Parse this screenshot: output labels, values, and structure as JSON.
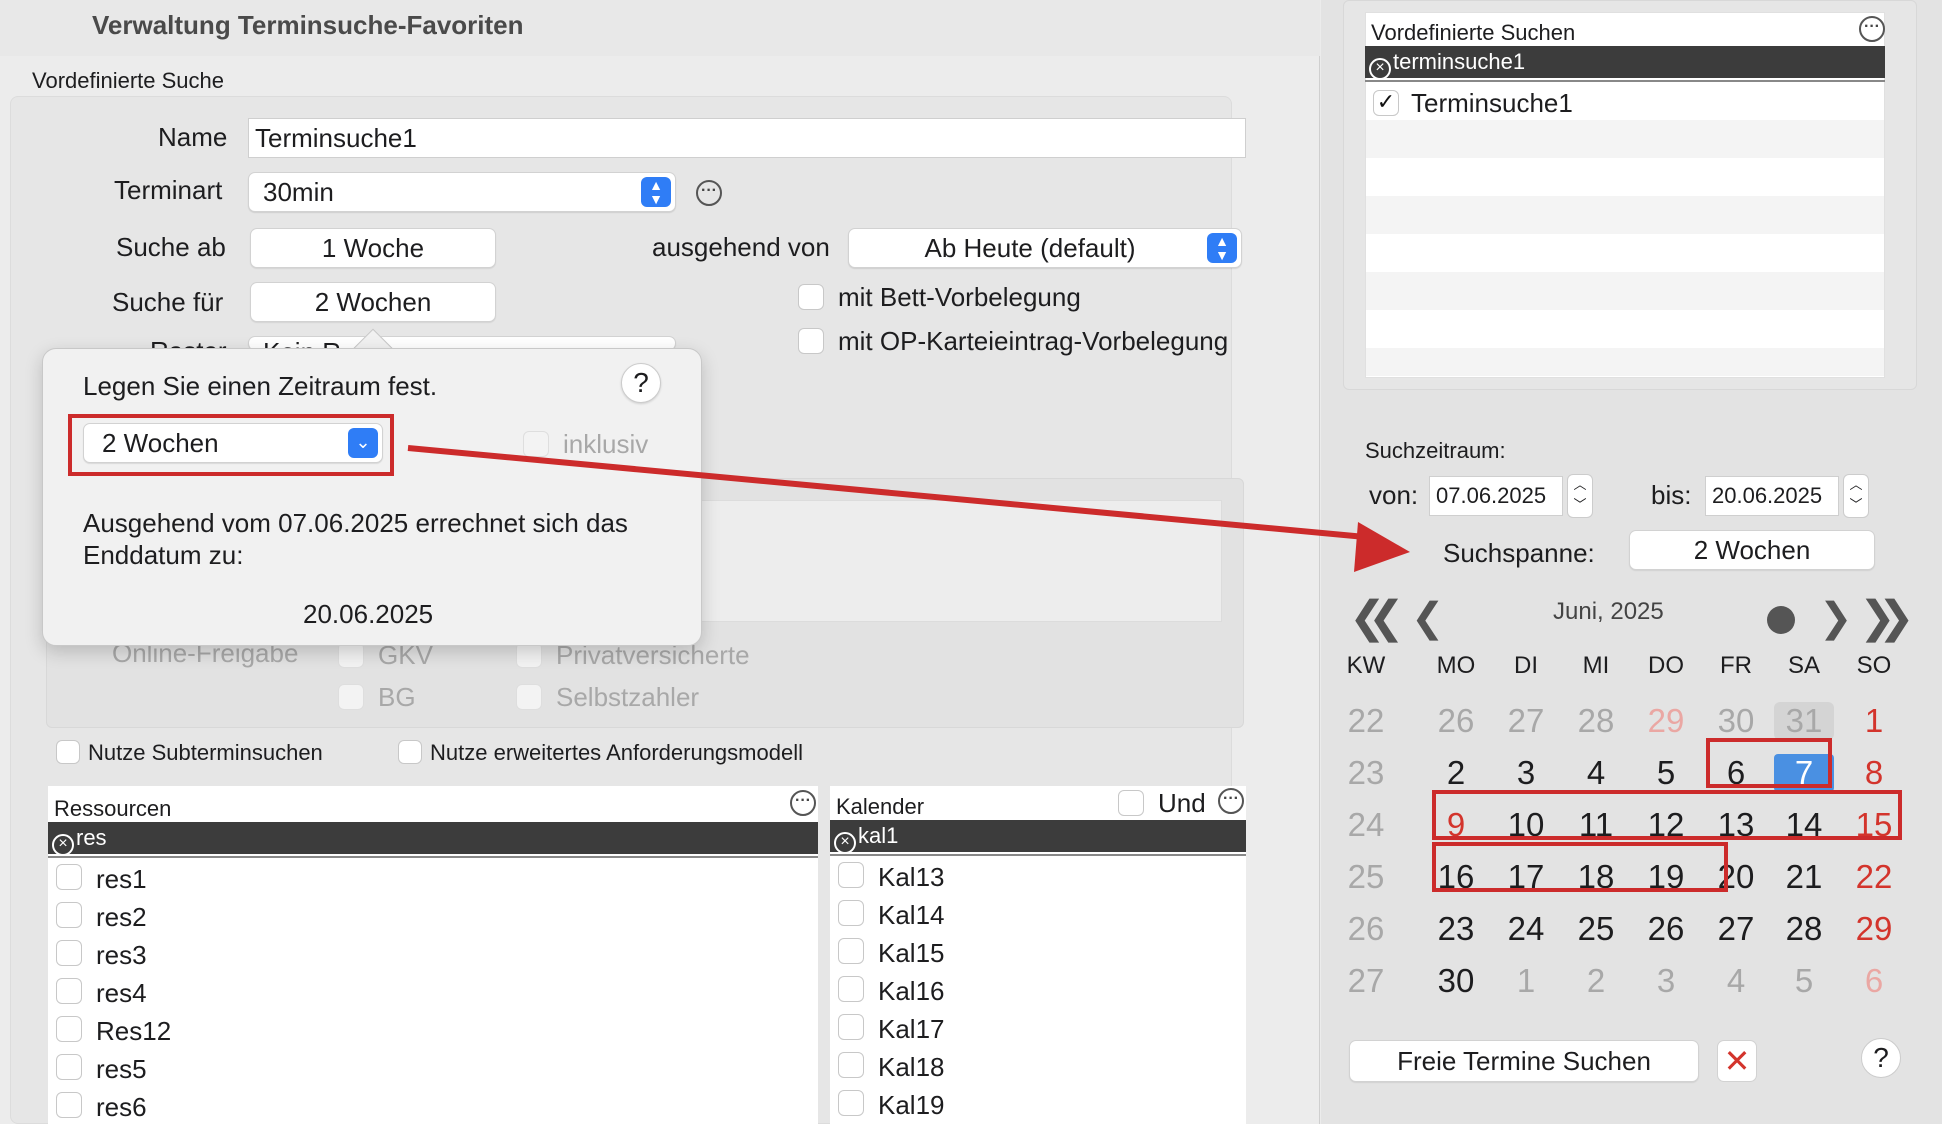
{
  "window": {
    "title": "Verwaltung Terminsuche-Favoriten"
  },
  "section_label": "Vordefinierte Suche",
  "form": {
    "name_label": "Name",
    "name_value": "Terminsuche1",
    "terminart_label": "Terminart",
    "terminart_value": "30min",
    "suche_ab_label": "Suche ab",
    "suche_ab_value": "1 Woche",
    "ausgehend_label": "ausgehend von",
    "ausgehend_value": "Ab Heute (default)",
    "suche_fuer_label": "Suche für",
    "suche_fuer_value": "2 Wochen",
    "bett_label": "mit Bett-Vorbelegung",
    "op_label": "mit OP-Karteieintrag-Vorbelegung",
    "obscured_row_label": "Raster",
    "obscured_row_value": "Kein R"
  },
  "popover": {
    "title": "Legen Sie einen Zeitraum fest.",
    "help": "?",
    "select_value": "2 Wochen",
    "inklusiv_label": "inklusiv",
    "text": "Ausgehend vom 07.06.2025 errechnet sich das Enddatum zu:",
    "end_date": "20.06.2025"
  },
  "behind_popover": {
    "online_label": "Online-Freigabe",
    "gkv": "GKV",
    "privat": "Privatversicherte",
    "bg": "BG",
    "selbst": "Selbstzahler"
  },
  "options": {
    "subtermin": "Nutze Subterminsuchen",
    "anforderung": "Nutze erweitertes Anforderungsmodell"
  },
  "ressourcen": {
    "header": "Ressourcen",
    "filter": "res",
    "items": [
      "res1",
      "res2",
      "res3",
      "res4",
      "Res12",
      "res5",
      "res6"
    ]
  },
  "kalender": {
    "header": "Kalender",
    "und_label": "Und",
    "filter": "kal1",
    "items": [
      "Kal13",
      "Kal14",
      "Kal15",
      "Kal16",
      "Kal17",
      "Kal18",
      "Kal19"
    ]
  },
  "predefined": {
    "header": "Vordefinierte Suchen",
    "filter": "terminsuche1",
    "items": [
      "Terminsuche1"
    ]
  },
  "suchzeitraum": {
    "label": "Suchzeitraum:",
    "von_label": "von:",
    "von_value": "07.06.2025",
    "bis_label": "bis:",
    "bis_value": "20.06.2025",
    "spanne_label": "Suchspanne:",
    "spanne_value": "2 Wochen"
  },
  "calendar": {
    "month": "Juni, 2025",
    "headers": [
      "KW",
      "MO",
      "DI",
      "MI",
      "DO",
      "FR",
      "SA",
      "SO"
    ],
    "weeks": [
      {
        "kw": "22",
        "days": [
          "26",
          "27",
          "28",
          "29",
          "30",
          "31",
          "1"
        ]
      },
      {
        "kw": "23",
        "days": [
          "2",
          "3",
          "4",
          "5",
          "6",
          "7",
          "8"
        ]
      },
      {
        "kw": "24",
        "days": [
          "9",
          "10",
          "11",
          "12",
          "13",
          "14",
          "15"
        ]
      },
      {
        "kw": "25",
        "days": [
          "16",
          "17",
          "18",
          "19",
          "20",
          "21",
          "22"
        ]
      },
      {
        "kw": "26",
        "days": [
          "23",
          "24",
          "25",
          "26",
          "27",
          "28",
          "29"
        ]
      },
      {
        "kw": "27",
        "days": [
          "30",
          "1",
          "2",
          "3",
          "4",
          "5",
          "6"
        ]
      }
    ],
    "selected_day": "7",
    "highlight_color": "#cc2b2b",
    "selected_color": "#4a90e2"
  },
  "footer": {
    "search_button": "Freie Termine Suchen",
    "help": "?"
  }
}
